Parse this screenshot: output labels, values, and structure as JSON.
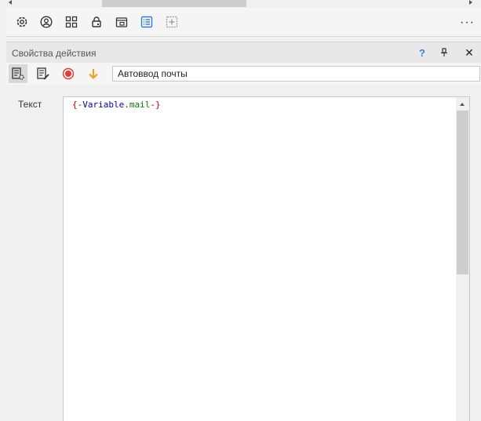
{
  "panel": {
    "title": "Свойства действия",
    "help_label": "?",
    "close_label": "✕"
  },
  "toolbar": {
    "icons": [
      "gear-icon",
      "user-circle-icon",
      "grid-icon",
      "lock-icon",
      "browser-lock-icon",
      "list-icon",
      "add-frame-icon"
    ],
    "more_label": "···",
    "active_icon": "list-icon",
    "accent": "#2f7fd5"
  },
  "action": {
    "name_value": "Автоввод почты",
    "record_color": "#e53935",
    "arrow_color": "#f0a020"
  },
  "field": {
    "label": "Текст",
    "code": {
      "open": "{-",
      "var": "Variable",
      "dot": ".",
      "name": "mail",
      "close": "-}"
    }
  }
}
